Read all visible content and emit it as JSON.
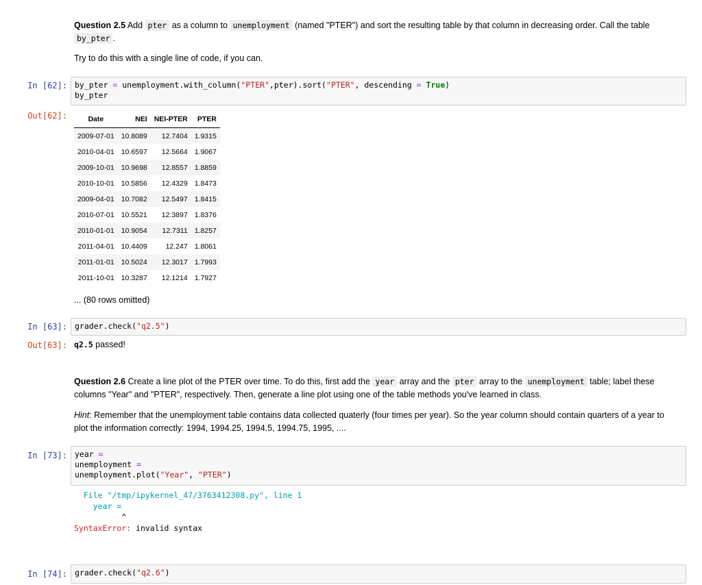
{
  "q25": {
    "title": "Question 2.5",
    "t1": " Add ",
    "c1": "pter",
    "t2": " as a column to ",
    "c2": "unemployment",
    "t3": " (named \"PTER\") and sort the resulting table by that column in decreasing order. Call the table",
    "c3": "by_pter",
    "t4": ".",
    "hint": "Try to do this with a single line of code, if you can."
  },
  "cell62": {
    "prompt_in": "In [62]:",
    "prompt_out": "Out[62]:",
    "code_line1_a": "by_pter ",
    "code_line1_eq": "=",
    "code_line1_b": " unemployment.with_column(",
    "code_line1_s1": "\"PTER\"",
    "code_line1_c": ",pter).sort(",
    "code_line1_s2": "\"PTER\"",
    "code_line1_d": ", descending ",
    "code_line1_eq2": "=",
    "code_line1_sp": " ",
    "code_line1_true": "True",
    "code_line1_e": ")",
    "code_line2": "by_pter",
    "table": {
      "headers": [
        "Date",
        "NEI",
        "NEI-PTER",
        "PTER"
      ],
      "rows": [
        [
          "2009-07-01",
          "10.8089",
          "12.7404",
          "1.9315"
        ],
        [
          "2010-04-01",
          "10.6597",
          "12.5664",
          "1.9067"
        ],
        [
          "2009-10-01",
          "10.9698",
          "12.8557",
          "1.8859"
        ],
        [
          "2010-10-01",
          "10.5856",
          "12.4329",
          "1.8473"
        ],
        [
          "2009-04-01",
          "10.7082",
          "12.5497",
          "1.8415"
        ],
        [
          "2010-07-01",
          "10.5521",
          "12.3897",
          "1.8376"
        ],
        [
          "2010-01-01",
          "10.9054",
          "12.7311",
          "1.8257"
        ],
        [
          "2011-04-01",
          "10.4409",
          "12.247",
          "1.8061"
        ],
        [
          "2011-01-01",
          "10.5024",
          "12.3017",
          "1.7993"
        ],
        [
          "2011-10-01",
          "10.3287",
          "12.1214",
          "1.7927"
        ]
      ],
      "omitted": "... (80 rows omitted)"
    }
  },
  "cell63": {
    "prompt_in": "In [63]:",
    "prompt_out": "Out[63]:",
    "code_a": "grader.check(",
    "code_s": "\"q2.5\"",
    "code_b": ")",
    "out_bold": "q2.5",
    "out_rest": " passed!"
  },
  "q26": {
    "title": "Question 2.6",
    "t1": " Create a line plot of the PTER over time. To do this, first add the ",
    "c1": "year",
    "t2": " array and the ",
    "c2": "pter",
    "t3": " array to the ",
    "c3": "unemployment",
    "t4": " table; label these columns \"Year\" and \"PTER\", respectively. Then, generate a line plot using one of the table methods you've learned in class.",
    "hint_label": "Hint",
    "hint_text": ": Remember that the unemployment table contains data collected quaterly (four times per year). So the year column should contain quarters of a year to plot the information correctly: 1994, 1994.25, 1994.5, 1994.75, 1995, ...."
  },
  "cell73": {
    "prompt_in": "In [73]:",
    "l1a": "year ",
    "l1eq": "=",
    "l2a": "unemployment ",
    "l2eq": "=",
    "l3a": "unemployment.plot(",
    "l3s1": "\"Year\"",
    "l3b": ", ",
    "l3s2": "\"PTER\"",
    "l3c": ")",
    "err_file": "  File \"/tmp/ipykernel_47/3763412308.py\", line 1",
    "err_code": "    year =",
    "err_caret": "          ^",
    "err_name": "SyntaxError:",
    "err_msg": " invalid syntax"
  },
  "cell74": {
    "prompt_in": "In [74]:",
    "code_a": "grader.check(",
    "code_s": "\"q2.6\"",
    "code_b": ")"
  }
}
